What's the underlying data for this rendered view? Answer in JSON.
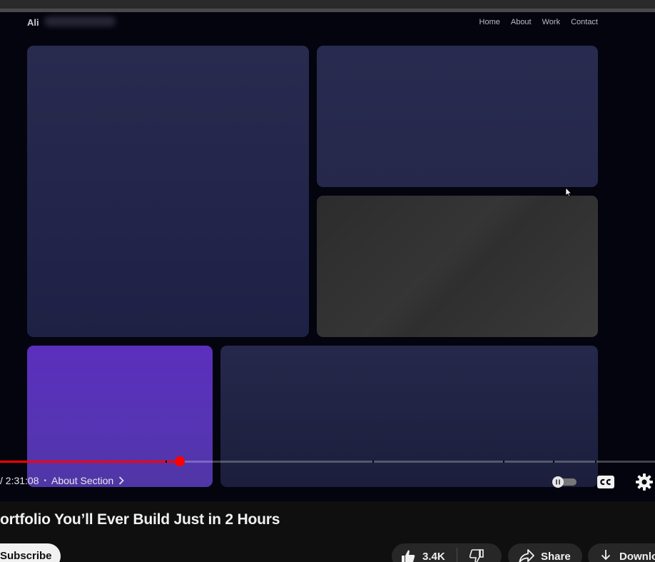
{
  "video": {
    "site_brand": "Ali",
    "site_nav": [
      "Home",
      "About",
      "Work",
      "Contact"
    ]
  },
  "player": {
    "progress": 0.275,
    "time_display": "/ 2:31:08",
    "chapter_label": "About Section"
  },
  "meta": {
    "title": "ortfolio You’ll Ever Build Just in 2 Hours",
    "subscribe_label": "Subscribe",
    "like_count": "3.4K",
    "share_label": "Share",
    "download_label": "Downlo"
  },
  "colors": {
    "progress": "#ff0000",
    "page_bg": "#0f0f0f",
    "button_bg": "#272727"
  },
  "icons": [
    "cursor-icon",
    "chevron-right-icon",
    "autoplay-toggle-icon",
    "cc-icon",
    "gear-icon",
    "thumbs-up-icon",
    "thumbs-down-icon",
    "share-icon",
    "download-icon"
  ]
}
